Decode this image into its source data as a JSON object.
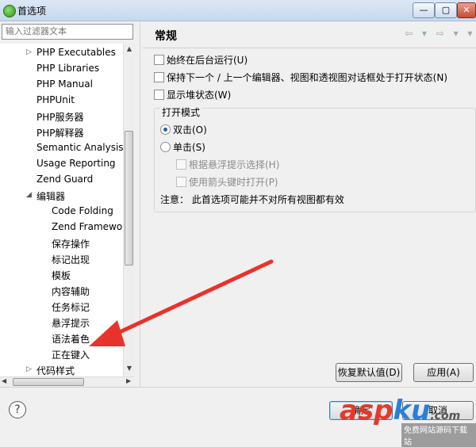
{
  "window": {
    "title": "首选项",
    "minimize_glyph": "—",
    "maximize_glyph": "▢",
    "close_glyph": "✕"
  },
  "filter": {
    "placeholder": "输入过滤器文本"
  },
  "tree": {
    "items": [
      {
        "label": "PHP Executables",
        "expandable": true
      },
      {
        "label": "PHP Libraries"
      },
      {
        "label": "PHP Manual"
      },
      {
        "label": "PHPUnit"
      },
      {
        "label": "PHP服务器"
      },
      {
        "label": "PHP解释器"
      },
      {
        "label": "Semantic Analysis"
      },
      {
        "label": "Usage Reporting"
      },
      {
        "label": "Zend Guard"
      },
      {
        "label": "编辑器",
        "expanded": true
      },
      {
        "label": "Code Folding"
      },
      {
        "label": "Zend Framewo"
      },
      {
        "label": "保存操作"
      },
      {
        "label": "标记出现"
      },
      {
        "label": "模板"
      },
      {
        "label": "内容辅助"
      },
      {
        "label": "任务标记"
      },
      {
        "label": "悬浮提示"
      },
      {
        "label": "语法着色"
      },
      {
        "label": "正在键入"
      },
      {
        "label": "代码样式",
        "expandable": true
      }
    ]
  },
  "page": {
    "title": "常规",
    "nav_icons": "⇦ ▾ ⇨ ▾ ▾",
    "options": [
      {
        "label": "始终在后台运行(U)",
        "checked": false
      },
      {
        "label": "保持下一个 / 上一个编辑器、视图和透视图对话框处于打开状态(N)",
        "checked": false
      },
      {
        "label": "显示堆状态(W)",
        "checked": false
      }
    ],
    "open_mode": {
      "title": "打开模式",
      "double_click": "双击(O)",
      "single_click": "单击(S)",
      "hover_select": "根据悬浮提示选择(H)",
      "arrow_open": "使用箭头键时打开(P)",
      "selected": "double"
    },
    "note": "注意：  此首选项可能并不对所有视图都有效",
    "restore_defaults": "恢复默认值(D)",
    "apply": "应用(A)"
  },
  "footer": {
    "help": "?",
    "ok": "确定",
    "cancel": "取消"
  },
  "watermark": {
    "brand_red": "asp",
    "brand_blue": "ku",
    "suffix": ".com",
    "sub": "免费网站源码下载站"
  },
  "colors": {
    "accent": "#2a5ca8",
    "watermark_red": "#e23a2c",
    "watermark_blue": "#2a7fd4"
  }
}
